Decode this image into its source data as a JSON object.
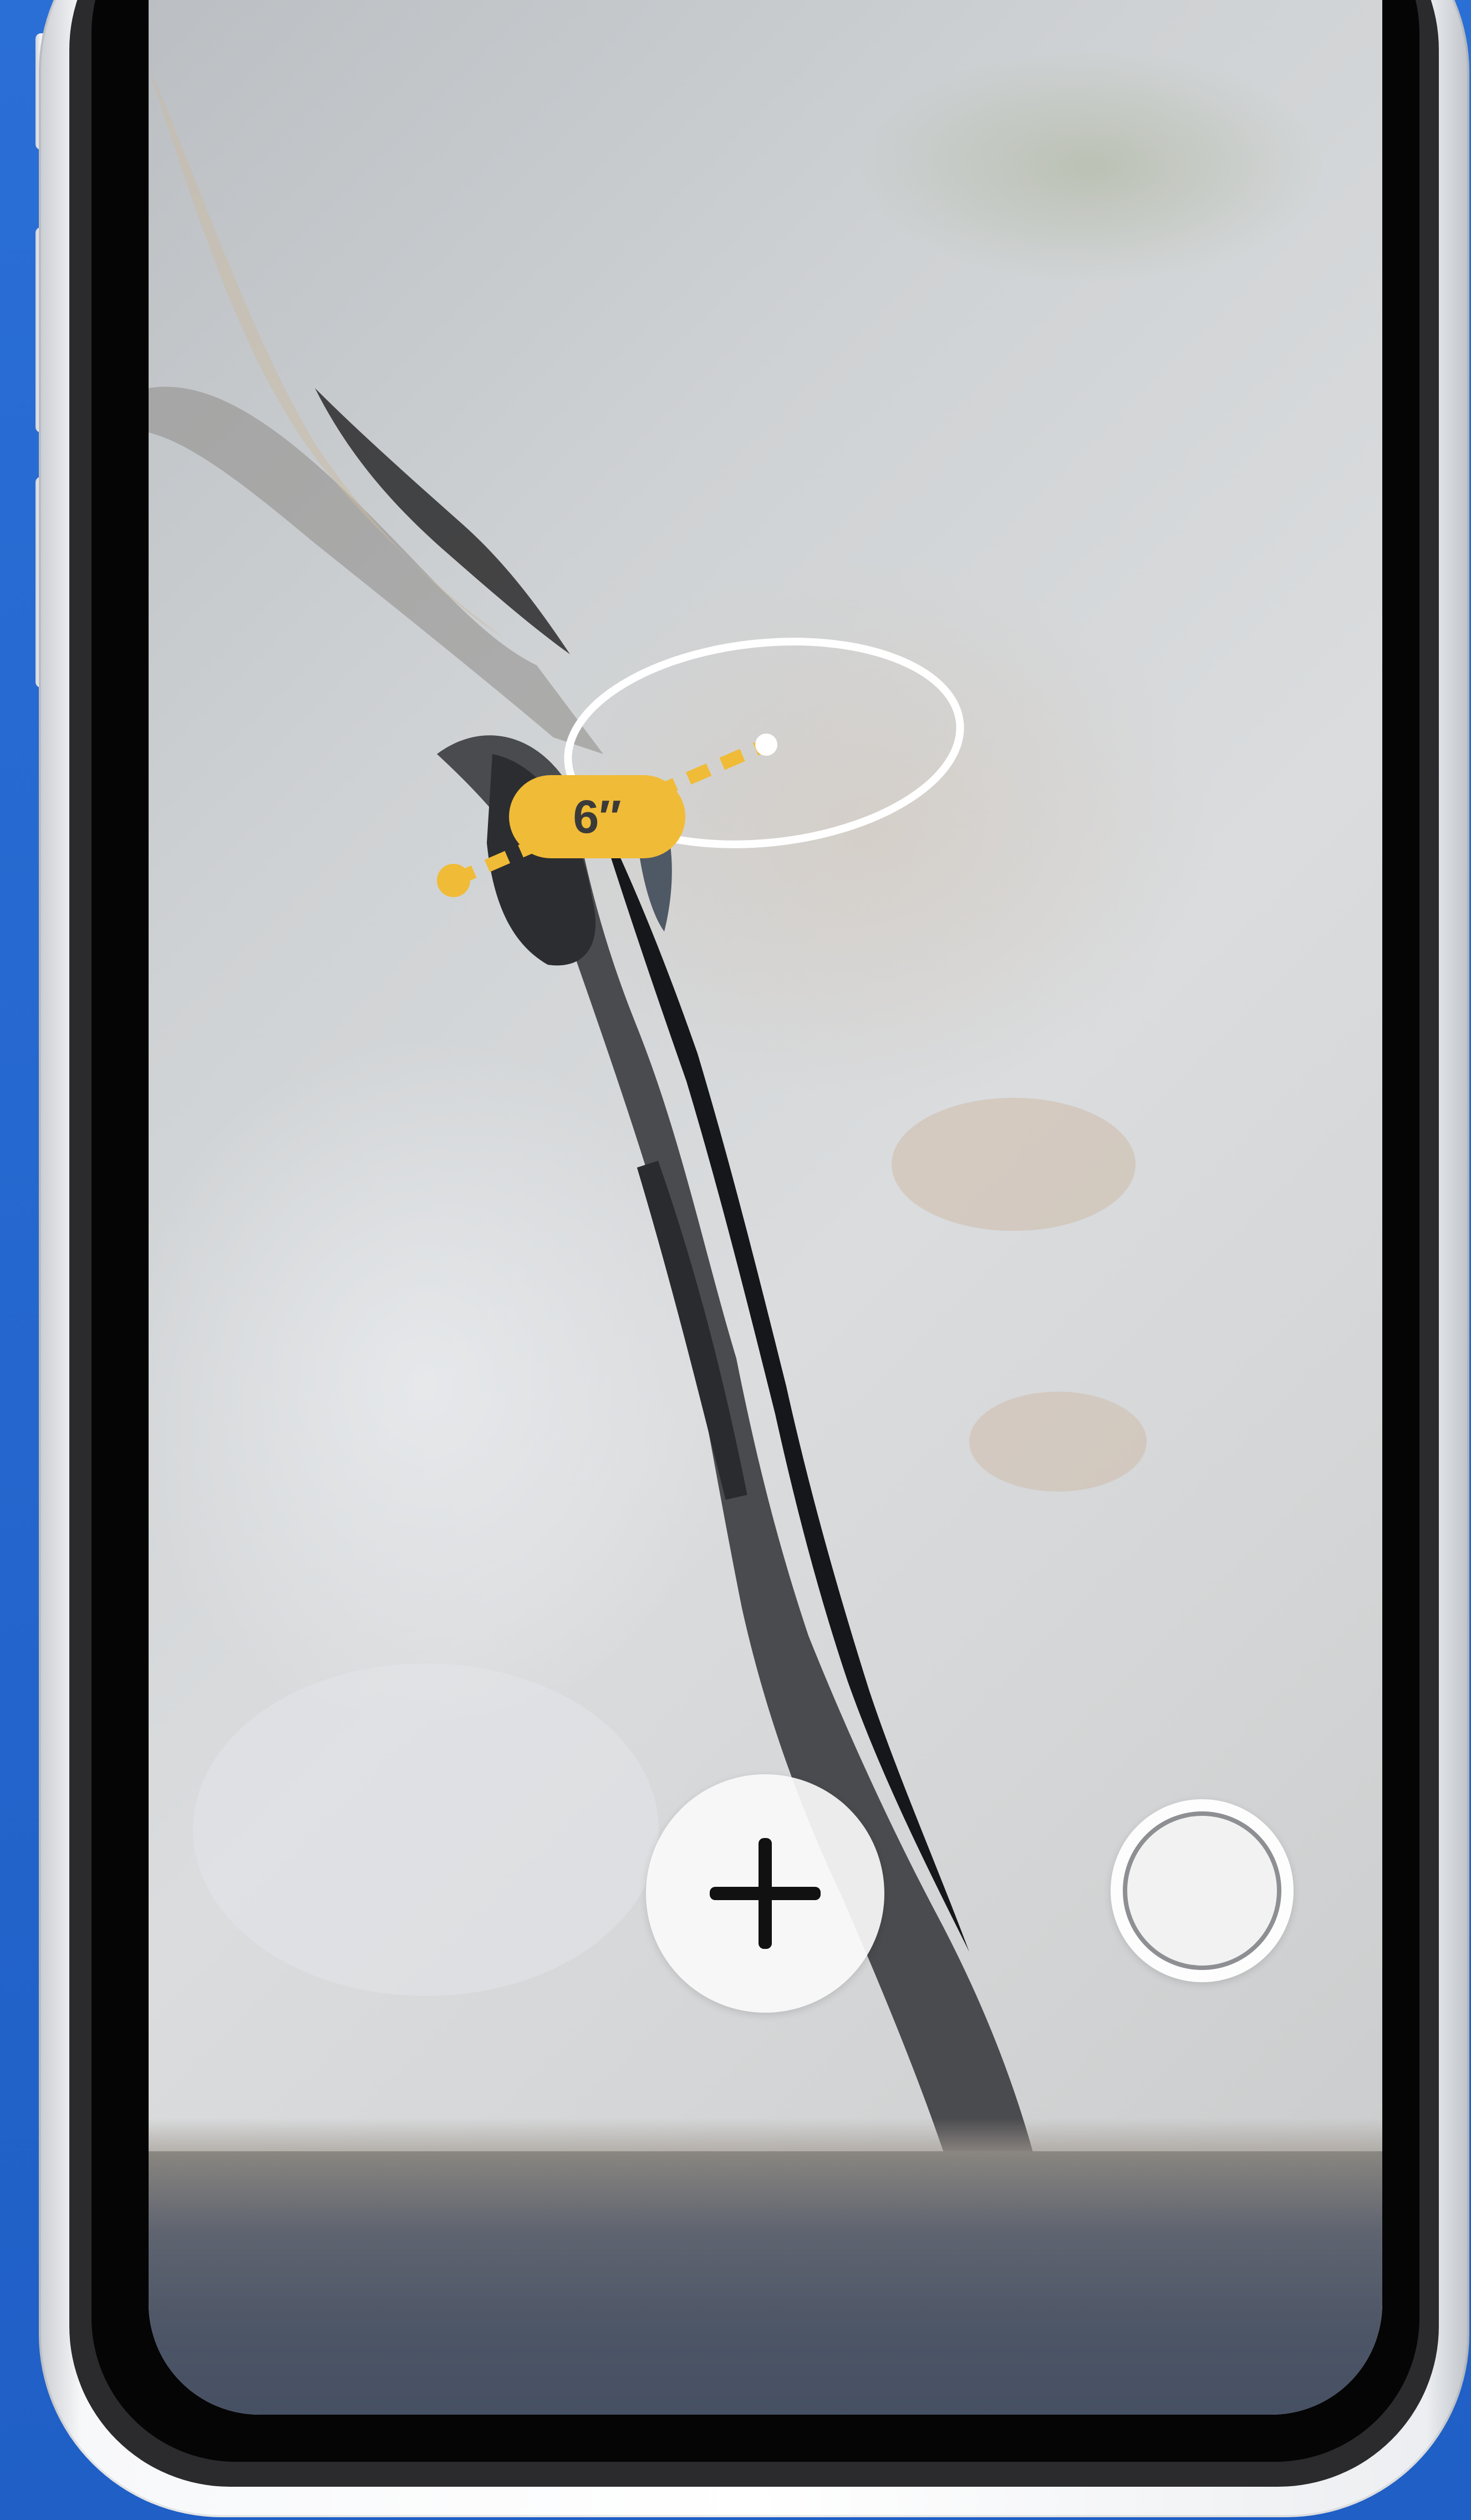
{
  "measurement": {
    "label": "6″"
  },
  "controls": {
    "add_button_icon": "plus-icon",
    "capture_button_icon": "shutter-icon"
  },
  "colors": {
    "background": "#2466cf",
    "measure_accent": "#f0bb36",
    "label_text": "#3a3a3a",
    "focus_ring": "#ffffff"
  }
}
